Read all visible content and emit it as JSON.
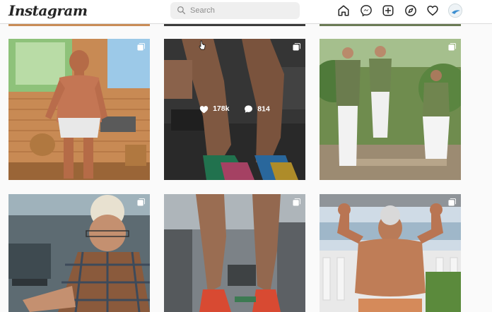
{
  "app": {
    "logo_text": "Instagram"
  },
  "search": {
    "placeholder": "Search",
    "value": ""
  },
  "nav": {
    "icons": [
      "home-icon",
      "messenger-icon",
      "new-post-icon",
      "explore-icon",
      "activity-heart-icon",
      "profile-avatar"
    ]
  },
  "grid": {
    "posts": [
      {
        "subject": "man in sauna with wooden bucket",
        "multi": true
      },
      {
        "subject": "calves close-up with colorful sneakers",
        "multi": true,
        "hovered": true,
        "likes": "178k",
        "comments": "814"
      },
      {
        "subject": "three men in green shirts in garden",
        "multi": true
      },
      {
        "subject": "blond man with plaid shirt at gym",
        "multi": true
      },
      {
        "subject": "calves in gym with red shoes",
        "multi": true
      },
      {
        "subject": "bodybuilder flexing on balcony",
        "multi": true
      }
    ]
  },
  "colors": {
    "text": "#262626",
    "border": "#dbdbdb",
    "search_bg": "#efefef",
    "page_bg": "#fafafa"
  }
}
